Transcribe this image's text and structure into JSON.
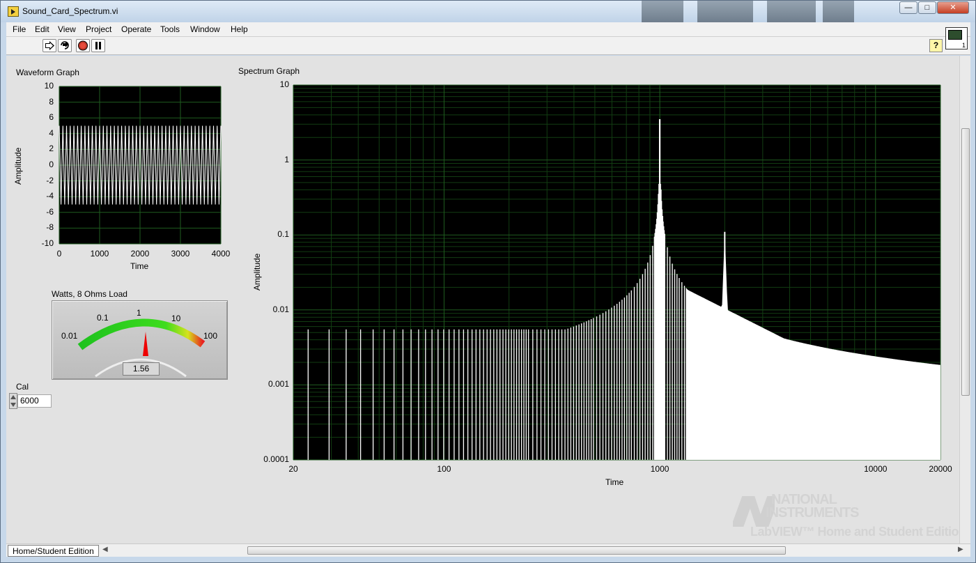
{
  "window": {
    "title": "Sound_Card_Spectrum.vi",
    "controls": {
      "minimize": "—",
      "maximize": "□",
      "close": "✕"
    }
  },
  "menu": [
    "File",
    "Edit",
    "View",
    "Project",
    "Operate",
    "Tools",
    "Window",
    "Help"
  ],
  "toolbar": {
    "buttons": [
      "run-arrow-icon",
      "run-continuously-icon",
      "abort-icon",
      "pause-icon"
    ],
    "help_label": "?",
    "vi_icon_number": "1"
  },
  "waveform_graph": {
    "label": "Waveform Graph",
    "chart_data": {
      "type": "line",
      "title": "Waveform Graph",
      "xlabel": "Time",
      "ylabel": "Amplitude",
      "xlim": [
        0,
        4000
      ],
      "ylim": [
        -10,
        10
      ],
      "x_ticks": [
        "0",
        "1000",
        "2000",
        "3000",
        "4000"
      ],
      "y_ticks": [
        "10",
        "8",
        "6",
        "4",
        "2",
        "0",
        "-2",
        "-4",
        "-6",
        "-8",
        "-10"
      ],
      "amplitude": 5,
      "grid": true,
      "colors": {
        "background": "#000000",
        "grid": "#1f5c1f",
        "trace": "#ffffff"
      }
    }
  },
  "spectrum_graph": {
    "label": "Spectrum Graph",
    "chart_data": {
      "type": "line",
      "title": "Spectrum Graph",
      "xlabel": "Time",
      "ylabel": "Amplitude",
      "x_scale": "log",
      "y_scale": "log",
      "xlim": [
        20,
        20000
      ],
      "ylim": [
        0.0001,
        10
      ],
      "x_ticks": [
        "20",
        "100",
        "1000",
        "10000",
        "20000"
      ],
      "y_ticks": [
        "10",
        "1",
        "0.1",
        "0.01",
        "0.001",
        "0.0001"
      ],
      "grid": true,
      "peaks": [
        {
          "x": 1000,
          "y": 3.5
        },
        {
          "x": 2000,
          "y": 0.11
        },
        {
          "x": 3000,
          "y": 0.0026
        }
      ],
      "noise_floor": 0.0055,
      "tail_end": {
        "x": 20000,
        "y": 0.00037
      },
      "colors": {
        "background": "#000000",
        "grid": "#1f5c1f",
        "trace": "#ffffff"
      }
    }
  },
  "meter": {
    "label": "Watts, 8 Ohms Load",
    "scale_labels": [
      "0.01",
      "0.1",
      "1",
      "10",
      "100"
    ],
    "value": 1.56,
    "readout": "1.56",
    "colors": {
      "low": "#22cc22",
      "high": "#ee2222",
      "needle": "#ee0000"
    }
  },
  "cal": {
    "label": "Cal",
    "value": "6000"
  },
  "status": {
    "edition": "Home/Student Edition"
  },
  "watermark": {
    "line1": "NATIONAL",
    "line2": "INSTRUMENTS",
    "line3": "LabVIEW™ Home and Student Edition"
  }
}
